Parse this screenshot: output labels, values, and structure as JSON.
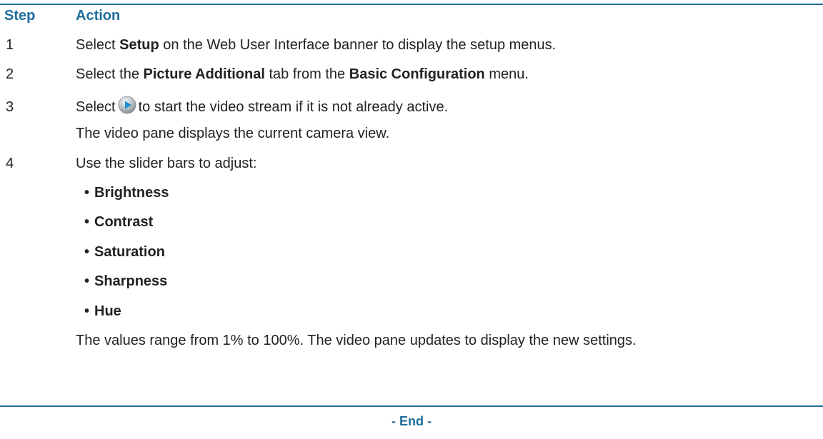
{
  "header": {
    "step": "Step",
    "action": "Action"
  },
  "steps": [
    {
      "number": "1",
      "parts": [
        "Select ",
        "Setup",
        " on the Web User Interface banner to display the setup menus."
      ]
    },
    {
      "number": "2",
      "parts": [
        "Select the ",
        "Picture Additional",
        " tab from the ",
        "Basic Configuration",
        " menu."
      ]
    },
    {
      "number": "3",
      "parts": [
        "Select",
        "to start the video stream if it is not already active."
      ],
      "icon": "play-button-icon",
      "note": "The video pane displays the current camera view."
    },
    {
      "number": "4",
      "text": "Use the slider bars to adjust:",
      "bullets": [
        "Brightness",
        "Contrast",
        "Saturation",
        "Sharpness",
        "Hue"
      ],
      "note": "The values range from 1% to 100%. The video pane updates to display the new settings."
    }
  ],
  "bullet_char": "•",
  "end_label": "- End -",
  "colors": {
    "accent": "#1f6e9c",
    "text": "#222222"
  }
}
